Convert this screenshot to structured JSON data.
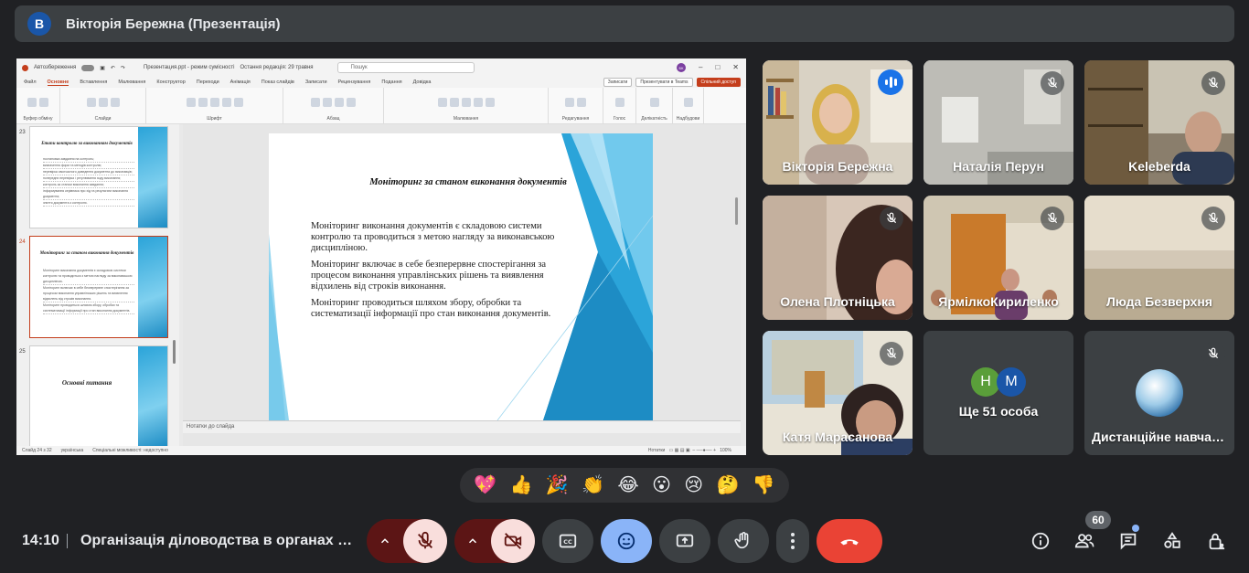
{
  "presenter_bar": {
    "avatar_letter": "B",
    "title": "Вікторія Бережна (Презентація)"
  },
  "powerpoint": {
    "titlebar": {
      "autosave": "Автозбереження",
      "filename": "Презентация.ppt - режим сумісності",
      "edit_state": "Остання редакція: 29 травня",
      "search_placeholder": "Пошук",
      "user_initials": "БК"
    },
    "tabs": [
      "Файл",
      "Основне",
      "Вставлення",
      "Малювання",
      "Конструктор",
      "Переходи",
      "Анімація",
      "Показ слайдів",
      "Записати",
      "Рецензування",
      "Подання",
      "Довідка"
    ],
    "active_tab": "Основне",
    "tab_buttons": {
      "notes": "Записати",
      "teams": "Презентувати в Teams",
      "share": "Спільний доступ"
    },
    "ribbon_groups": [
      "Буфер обміну",
      "Слайди",
      "Шрифт",
      "Абзац",
      "Малювання",
      "Редагування",
      "Голос",
      "Делікатність",
      "Надбудови"
    ],
    "thumbnails": [
      {
        "num": "23",
        "title": "Етапи контролю за виконанням документів",
        "lines": [
          "постановка завдання на контроль;",
          "визначення форм та методів контролю;",
          "перевірка своєчасного доведення документа до виконавців;",
          "попереднє перевірка і регулювання ходу виконання;",
          "контроль за станом виконання завдання;",
          "інформування керівника про хід та результати виконання документа;",
          "зняття документа з контролю."
        ]
      },
      {
        "num": "24",
        "title": "Моніторинг за станом виконання документів",
        "lines": [
          "Моніторинг виконання документів є складовою системи контролю та проводиться з метою нагляду за виконавською дисципліною.",
          "Моніторинг включає в себе безперервне спостерігання за процесом виконання управлінських рішень та виявлення відхилень від строків виконання.",
          "Моніторинг проводиться шляхом збору, обробки та систематизації інформації про стан виконання документів."
        ]
      },
      {
        "num": "25",
        "title": "Основні питання",
        "lines": []
      }
    ],
    "slide": {
      "title": "Моніторинг за станом виконання документів",
      "paragraphs": [
        "Моніторинг виконання документів є складовою системи контролю та проводиться з метою нагляду за виконавською дисципліною.",
        "Моніторинг включає в себе безперервне спостерігання за процесом виконання управлінських рішень та виявлення відхилень від строків виконання.",
        "Моніторинг проводиться шляхом збору, обробки та систематизації інформації про стан виконання документів."
      ]
    },
    "notes_placeholder": "Нотатки до слайда",
    "status": {
      "slide": "Слайд 24 з 32",
      "lang": "українська",
      "accessibility": "Спеціальні можливості: недоступно",
      "notes": "Нотатки",
      "zoom": "100%"
    }
  },
  "participants": [
    {
      "name": "Вікторія Бережна",
      "state": "speaking"
    },
    {
      "name": "Наталія Перун",
      "state": "muted"
    },
    {
      "name": "Keleberda",
      "state": "muted"
    },
    {
      "name": "Олена Плотніцька",
      "state": "muted"
    },
    {
      "name": "ЯрмілкоКириленко",
      "state": "muted"
    },
    {
      "name": "Люда Безверхня",
      "state": "muted"
    },
    {
      "name": "Катя Марасанова",
      "state": "muted"
    },
    {
      "name": "Ще 51 особа",
      "state": "group",
      "avatars": [
        "Н",
        "М"
      ]
    },
    {
      "name": "Дистанційне навчання",
      "state": "muted"
    }
  ],
  "reactions": [
    "💖",
    "👍",
    "🎉",
    "👏",
    "😂",
    "😮",
    "😢",
    "🤔",
    "👎"
  ],
  "toolbar": {
    "time": "14:10",
    "meeting_title": "Організація діловодства в органах влади",
    "people_count": "60"
  },
  "colors": {
    "speaking": "#1a73e8",
    "hangup": "#ea4335",
    "active_blue": "#8ab4f8",
    "ppt_accent": "#c43e1c"
  }
}
